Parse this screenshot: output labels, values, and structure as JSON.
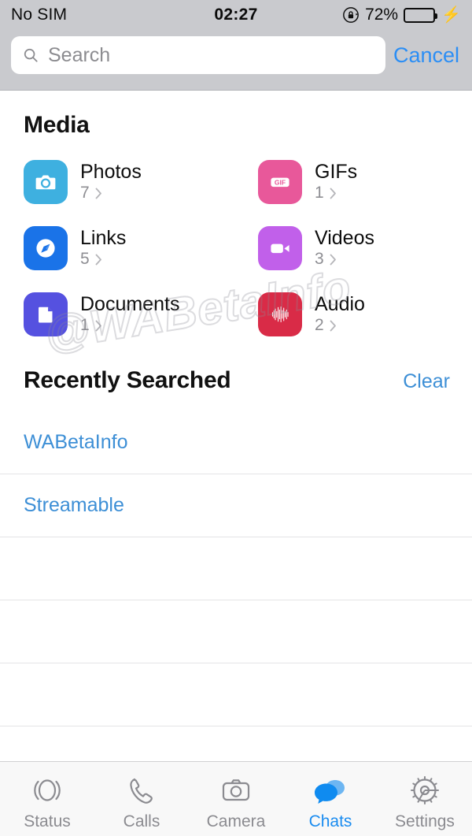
{
  "status_bar": {
    "carrier": "No SIM",
    "time": "02:27",
    "battery_percent": "72%",
    "battery_level": 72,
    "rotation_lock_icon": "rotation-lock-icon",
    "charging_icon": "lightning-bolt-icon"
  },
  "search": {
    "placeholder": "Search",
    "value": "",
    "search_icon": "search-icon",
    "cancel_label": "Cancel"
  },
  "media": {
    "title": "Media",
    "items": [
      {
        "label": "Photos",
        "count": "7",
        "icon": "camera-icon",
        "color": "#3eb0e0"
      },
      {
        "label": "GIFs",
        "count": "1",
        "icon": "gif-icon",
        "color": "#e8589a"
      },
      {
        "label": "Links",
        "count": "5",
        "icon": "compass-icon",
        "color": "#1a73e8"
      },
      {
        "label": "Videos",
        "count": "3",
        "icon": "video-icon",
        "color": "#c160ea"
      },
      {
        "label": "Documents",
        "count": "1",
        "icon": "document-icon",
        "color": "#5551e0"
      },
      {
        "label": "Audio",
        "count": "2",
        "icon": "waveform-icon",
        "color": "#d92b47"
      }
    ]
  },
  "recently_searched": {
    "title": "Recently Searched",
    "clear_label": "Clear",
    "items": [
      {
        "label": "WABetaInfo"
      },
      {
        "label": "Streamable"
      }
    ],
    "empty_rows": 3
  },
  "watermark": {
    "text": "@WABetaInfo"
  },
  "tabbar": {
    "tabs": [
      {
        "label": "Status",
        "icon": "status-rings-icon",
        "active": false
      },
      {
        "label": "Calls",
        "icon": "phone-icon",
        "active": false
      },
      {
        "label": "Camera",
        "icon": "camera-outline-icon",
        "active": false
      },
      {
        "label": "Chats",
        "icon": "chat-bubbles-icon",
        "active": true
      },
      {
        "label": "Settings",
        "icon": "gear-icon",
        "active": false
      }
    ]
  },
  "colors": {
    "accent_blue": "#1a8cf0",
    "link_blue": "#3d8fd6",
    "cancel_blue": "#2b8ef5",
    "status_bg": "#c9cace",
    "battery_green": "#4bd964"
  }
}
